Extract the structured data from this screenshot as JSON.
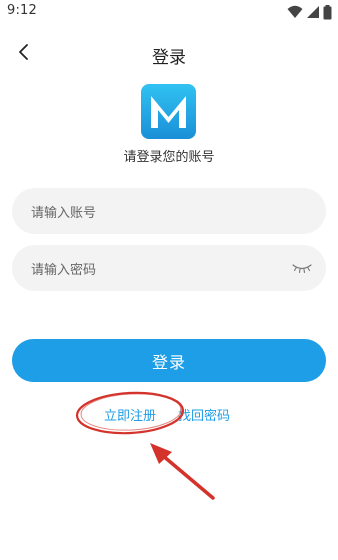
{
  "status_bar": {
    "time": "9:12",
    "icons": [
      "wifi-icon",
      "signal-icon",
      "battery-icon"
    ]
  },
  "header": {
    "title": "登录",
    "back_icon": "chevron-left-icon"
  },
  "app": {
    "logo_letter": "M",
    "subtitle": "请登录您的账号"
  },
  "form": {
    "account_placeholder": "请输入账号",
    "password_placeholder": "请输入密码",
    "password_toggle_icon": "eye-closed-icon"
  },
  "actions": {
    "login_label": "登录",
    "register_label": "立即注册",
    "forgot_label": "找回密码"
  },
  "colors": {
    "accent": "#1e9ee6",
    "field_bg": "#f3f3f3",
    "annotation": "#d3332b",
    "logo_gradient_top": "#31c2f2",
    "logo_gradient_bottom": "#1a8fd7"
  }
}
